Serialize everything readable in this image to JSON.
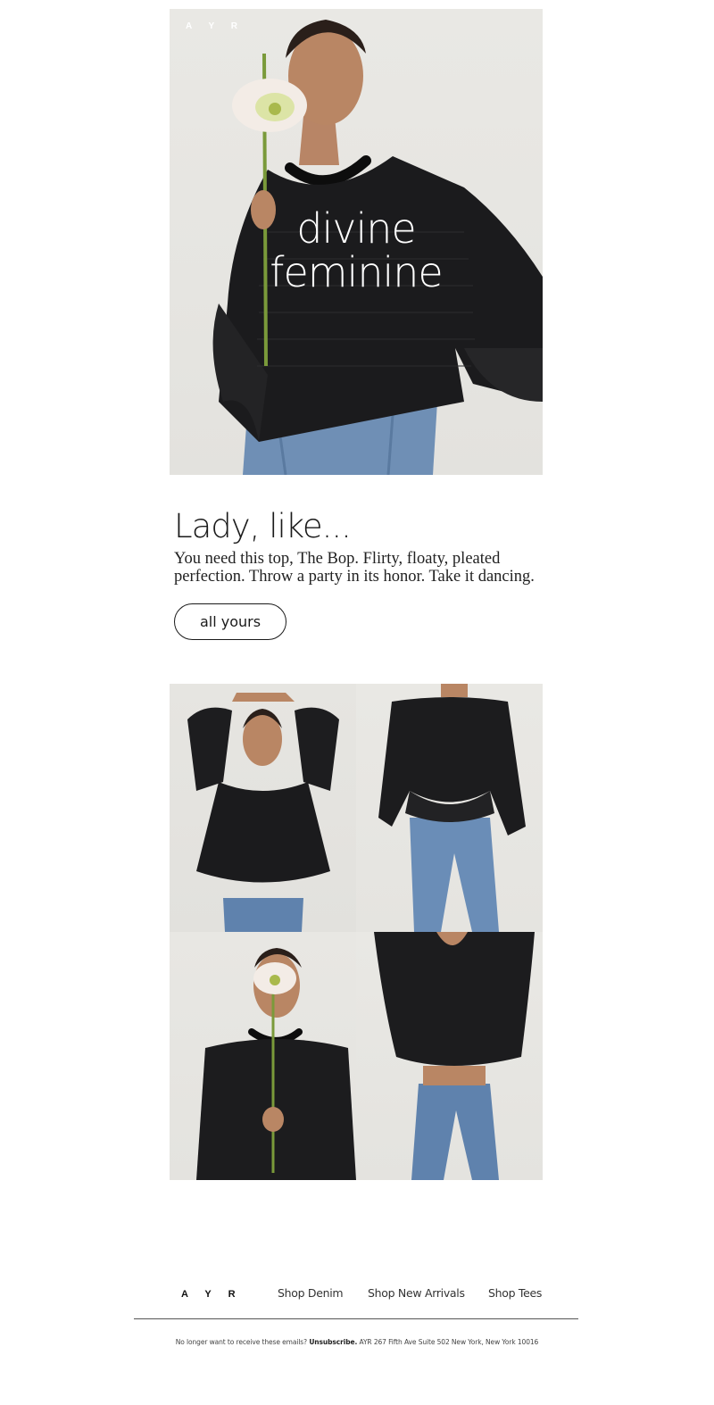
{
  "brand": {
    "logo": "A Y R"
  },
  "hero": {
    "title_line1": "divine",
    "title_line2": "feminine"
  },
  "copy": {
    "headline": "Lady, like...",
    "body": "You need this top, The Bop. Flirty, floaty, pleated perfection. Throw a party in its honor. Take it dancing.",
    "cta_label": "all yours"
  },
  "footer": {
    "logo": "A Y R",
    "links": [
      "Shop Denim",
      "Shop New Arrivals",
      "Shop Tees"
    ],
    "legal_prefix": "No longer want to receive these emails?",
    "unsubscribe": "Unsubscribe.",
    "address": "AYR 267 Fifth Ave Suite 502 New York, New York 10016"
  },
  "colors": {
    "background": "#ffffff",
    "photo_backdrop": "#e7e6e2",
    "top_black": "#1b1b1d",
    "denim": "#6f8fb5",
    "text": "#1a1a1a"
  }
}
